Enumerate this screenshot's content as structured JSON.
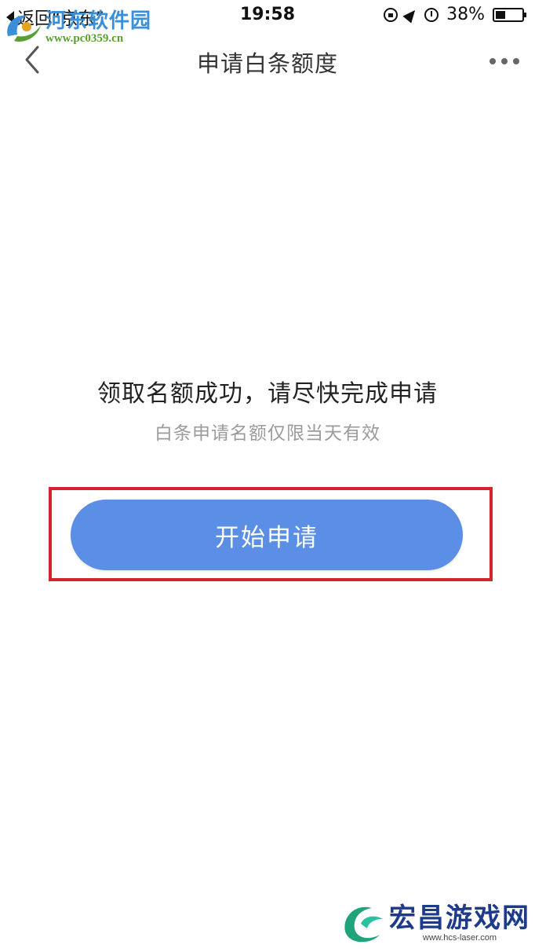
{
  "status_bar": {
    "back_label": "返回“京东”",
    "time": "19:58",
    "battery_percent": "38%",
    "battery_level": 0.38,
    "icons": [
      "rotation-lock-icon",
      "location-arrow-icon",
      "alarm-icon",
      "battery-icon"
    ]
  },
  "nav": {
    "title": "申请白条额度",
    "back_icon": "chevron-left-icon",
    "more_icon": "more-dots-icon"
  },
  "main": {
    "headline": "领取名额成功，请尽快完成申请",
    "subline": "白条申请名额仅限当天有效",
    "apply_button_label": "开始申请"
  },
  "watermarks": {
    "top_title": "河东软件园",
    "top_url": "www.pc0359.cn",
    "bottom_title": "宏昌游戏网",
    "bottom_url": "www.hcs-laser.com"
  },
  "colors": {
    "button": "#5b8fe6",
    "highlight_border": "#d4252f",
    "subtext": "#9b9b9b"
  }
}
